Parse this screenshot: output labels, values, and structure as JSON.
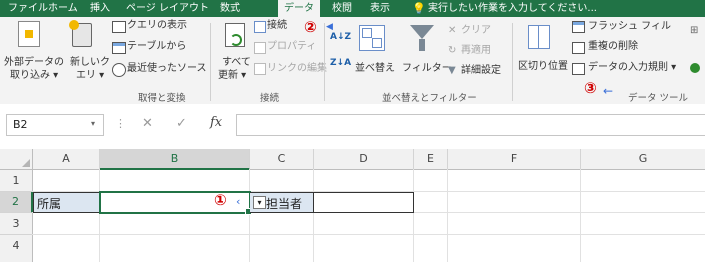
{
  "tabs": [
    "ファイル",
    "ホーム",
    "挿入",
    "ページ レイアウト",
    "数式",
    "データ",
    "校閲",
    "表示"
  ],
  "tell_me": "実行したい作業を入力してください...",
  "ribbon": {
    "get_external": [
      "外部データの",
      "取り込み ▾"
    ],
    "new_query": [
      "新しいク",
      "エリ ▾"
    ],
    "show_query": "クエリの表示",
    "from_table": "テーブルから",
    "recent_sources": "最近使ったソース",
    "group_get": "取得と変換",
    "refresh_all": [
      "すべて",
      "更新 ▾"
    ],
    "connections": "接続",
    "properties": "プロパティ",
    "edit_links": "リンクの編集",
    "group_conn": "接続",
    "sort_az": "A↓Z",
    "sort_za": "Z↓A",
    "sort": "並べ替え",
    "filter": "フィルター",
    "clear": "クリア",
    "reapply": "再適用",
    "advanced": "詳細設定",
    "group_sort": "並べ替えとフィルター",
    "text_to_columns": "区切り位置",
    "flash_fill": "フラッシュ フィル",
    "remove_dup": "重複の削除",
    "data_validation": "データの入力規則 ▾",
    "group_tools": "データ ツール"
  },
  "callouts": {
    "one": "①",
    "two": "②",
    "three": "③"
  },
  "formula_bar": {
    "name_box": "B2",
    "fx": "fx",
    "cancel": "✕",
    "enter": "✓",
    "dots": "⋮",
    "formula": ""
  },
  "columns": [
    "A",
    "B",
    "C",
    "D",
    "E",
    "F",
    "G"
  ],
  "rows": [
    "1",
    "2",
    "3",
    "4"
  ],
  "cells": {
    "A2": "所属",
    "C2": "担当者"
  },
  "colors": {
    "brand": "#217346",
    "callout": "#d00000",
    "selected_fill": "#dce6f1"
  }
}
